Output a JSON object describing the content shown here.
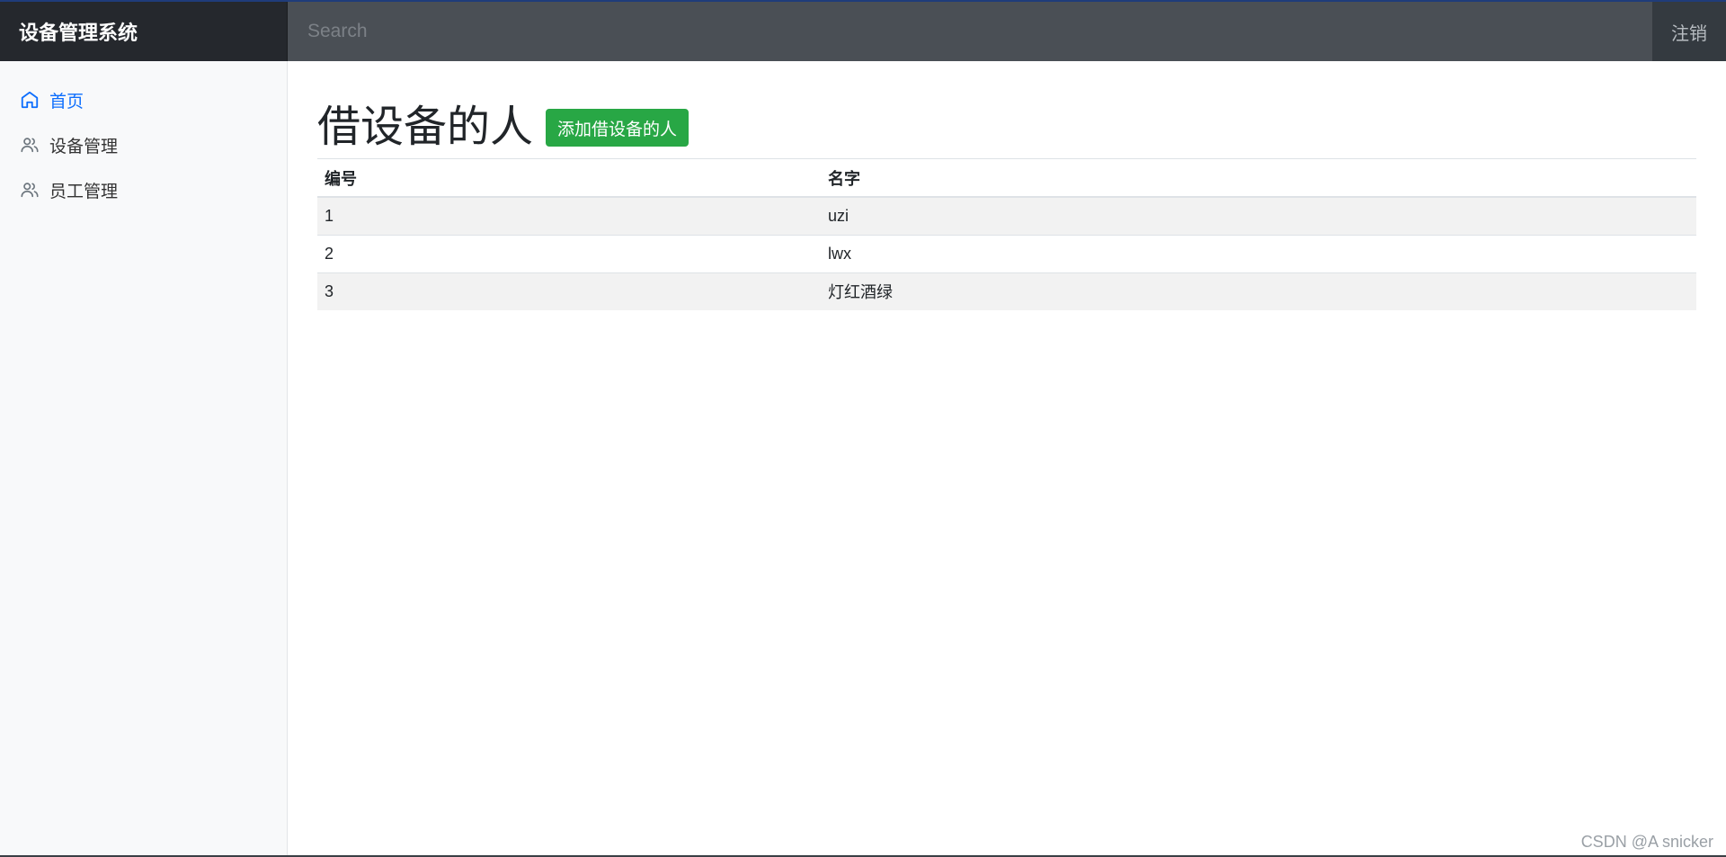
{
  "header": {
    "brand": "设备管理系统",
    "search_placeholder": "Search",
    "logout_label": "注销"
  },
  "sidebar": {
    "items": [
      {
        "label": "首页",
        "icon": "home-icon",
        "active": true
      },
      {
        "label": "设备管理",
        "icon": "users-icon",
        "active": false
      },
      {
        "label": "员工管理",
        "icon": "users-icon",
        "active": false
      }
    ]
  },
  "main": {
    "title": "借设备的人",
    "add_button_label": "添加借设备的人",
    "table": {
      "headers": [
        "编号",
        "名字"
      ],
      "rows": [
        [
          "1",
          "uzi"
        ],
        [
          "2",
          "lwx"
        ],
        [
          "3",
          "灯红酒绿"
        ]
      ]
    }
  },
  "watermark": "CSDN @A snicker",
  "colors": {
    "navbar": "#343a40",
    "brand_bg": "#25282d",
    "search_bg": "#4a4f55",
    "active_link": "#0d6efd",
    "success": "#28a745",
    "sidebar_bg": "#f8f9fa",
    "striped_row": "#f2f2f2"
  }
}
